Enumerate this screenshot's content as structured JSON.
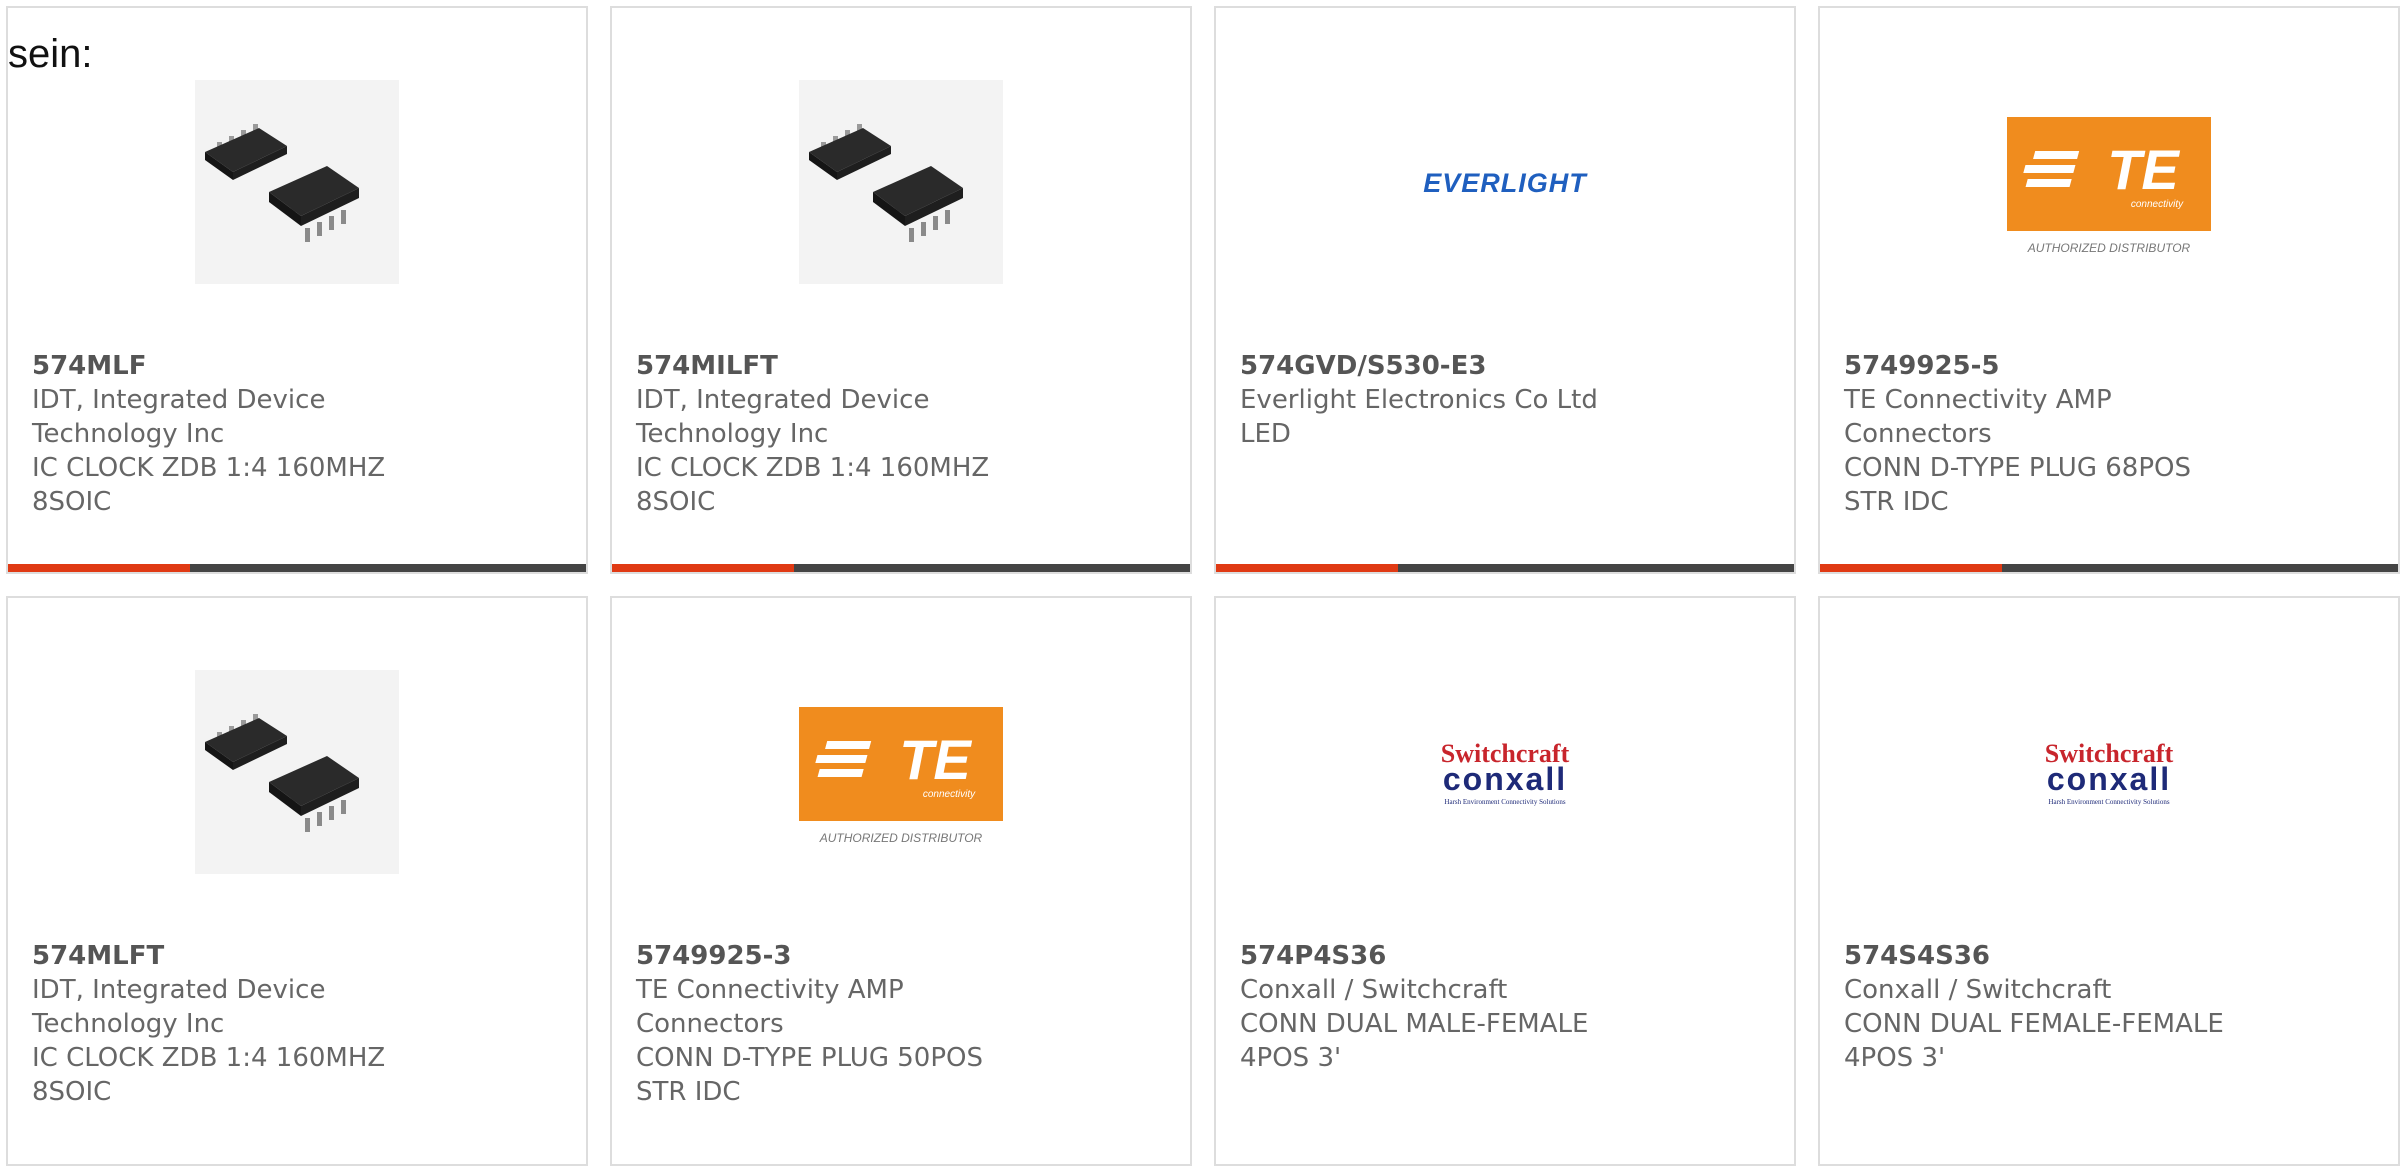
{
  "page": {
    "label": "sein:"
  },
  "brand_colors": {
    "accent": "#e03a14",
    "bar": "#444444",
    "te_orange": "#f08c1e",
    "everlight_blue": "#1f5fbf",
    "switchcraft_red": "#c8252c",
    "conxall_navy": "#1e2a78"
  },
  "logos": {
    "everlight": "EVERLIGHT",
    "te_mark": "TE",
    "te_sub": "connectivity",
    "te_dist": "AUTHORIZED DISTRIBUTOR",
    "switchcraft": "Switchcraft",
    "conxall": "conxall",
    "conxall_sub": "Harsh Environment Connectivity Solutions"
  },
  "products": [
    {
      "part": "574MLF",
      "manufacturer": "IDT, Integrated Device Technology Inc",
      "description": "IC CLOCK ZDB 1:4 160MHZ 8SOIC",
      "image_icon": "ic-chip-icon"
    },
    {
      "part": "574MILFT",
      "manufacturer": "IDT, Integrated Device Technology Inc",
      "description": "IC CLOCK ZDB 1:4 160MHZ 8SOIC",
      "image_icon": "ic-chip-icon"
    },
    {
      "part": "574GVD/S530-E3",
      "manufacturer": "Everlight Electronics Co Ltd",
      "description": "LED",
      "image_icon": "everlight-logo"
    },
    {
      "part": "5749925-5",
      "manufacturer": "TE Connectivity AMP Connectors",
      "description": "CONN D-TYPE PLUG 68POS STR IDC",
      "image_icon": "te-logo"
    },
    {
      "part": "574MLFT",
      "manufacturer": "IDT, Integrated Device Technology Inc",
      "description": "IC CLOCK ZDB 1:4 160MHZ 8SOIC",
      "image_icon": "ic-chip-icon"
    },
    {
      "part": "5749925-3",
      "manufacturer": "TE Connectivity AMP Connectors",
      "description": "CONN D-TYPE PLUG 50POS STR IDC",
      "image_icon": "te-logo"
    },
    {
      "part": "574P4S36",
      "manufacturer": "Conxall / Switchcraft",
      "description": "CONN DUAL MALE-FEMALE 4POS 3'",
      "image_icon": "switchcraft-logo"
    },
    {
      "part": "574S4S36",
      "manufacturer": "Conxall / Switchcraft",
      "description": "CONN DUAL FEMALE-FEMALE 4POS 3'",
      "image_icon": "switchcraft-logo"
    }
  ]
}
